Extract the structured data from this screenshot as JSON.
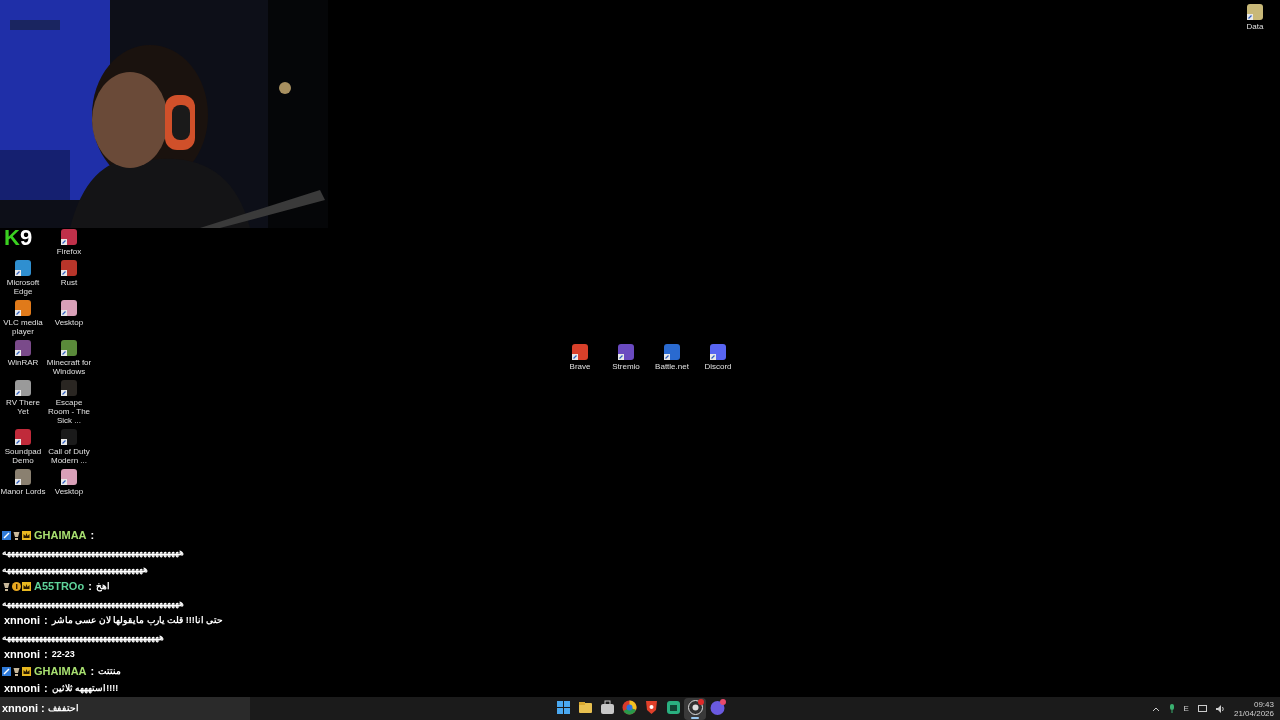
{
  "overlay_logo": {
    "letter": "K",
    "digit": "9"
  },
  "desktop_left_top": {
    "label": "Firefox",
    "color": "#c0304a"
  },
  "desktop_left": [
    {
      "label": "Microsoft Edge",
      "color": "#2f8fd0"
    },
    {
      "label": "Rust",
      "color": "#b8352a"
    },
    {
      "label": "VLC media player",
      "color": "#e07a1a"
    },
    {
      "label": "Vesktop",
      "color": "#d9a0b8"
    },
    {
      "label": "WinRAR",
      "color": "#7a4a8a"
    },
    {
      "label": "Minecraft for Windows",
      "color": "#5a8a3a"
    },
    {
      "label": "RV There Yet",
      "color": "#9a9a9a"
    },
    {
      "label": "Escape Room - The Sick ...",
      "color": "#2a2622"
    },
    {
      "label": "Soundpad Demo",
      "color": "#c02a3a"
    },
    {
      "label": "Call of Duty Modern ...",
      "color": "#1a1a1a"
    },
    {
      "label": "Manor Lords",
      "color": "#8a8070"
    },
    {
      "label": "Vesktop",
      "color": "#d9a0b8"
    }
  ],
  "desktop_center": [
    {
      "label": "Brave",
      "color": "#d8402a"
    },
    {
      "label": "Stremio",
      "color": "#6a4ac0"
    },
    {
      "label": "Battle.net",
      "color": "#2a6ad0"
    },
    {
      "label": "Discord",
      "color": "#5865f2"
    }
  ],
  "desktop_corner": {
    "label": "Data",
    "color": "#c8b878"
  },
  "chat": [
    {
      "user": "GHAIMAA",
      "separator": ":",
      "color": "#a8e070",
      "badges": [
        {
          "kind": "mod"
        },
        {
          "kind": "cup"
        },
        {
          "kind": "crown"
        }
      ],
      "lines": [
        "ههههههههههههههههههههههههههههههههههههههههههههه",
        "هههههههههههههههههههههههههههههههههههه"
      ]
    },
    {
      "user": "A55TROo",
      "separator": ":",
      "color": "#5fd39a",
      "badges": [
        {
          "kind": "cup"
        },
        {
          "kind": "coin"
        },
        {
          "kind": "crown"
        }
      ],
      "text": "اهخ",
      "lines": [
        "ههههههههههههههههههههههههههههههههههههههههههههه"
      ]
    },
    {
      "user": "xnnoni",
      "separator": ":",
      "color": "#ffffff",
      "text": "حتى انا!!! قلت يارب مايقولها لان عسى ماشر",
      "lines": [
        "هههههههههههههههههههههههههههههههههههههههه"
      ]
    },
    {
      "user": "xnnoni",
      "separator": ":",
      "color": "#ffffff",
      "text": "22-23"
    },
    {
      "user": "GHAIMAA",
      "separator": ":",
      "color": "#a8e070",
      "badges": [
        {
          "kind": "mod"
        },
        {
          "kind": "cup"
        },
        {
          "kind": "crown"
        }
      ],
      "text": "منتتت"
    },
    {
      "user": "xnnoni",
      "separator": ":",
      "color": "#ffffff",
      "text": "!!!!استهههه ثلاثين"
    }
  ],
  "chat_last": {
    "user": "xnnoni",
    "separator": ":",
    "text": "احتففف"
  },
  "taskbar": [
    {
      "kind": "start",
      "selected": false
    },
    {
      "kind": "folder",
      "selected": false
    },
    {
      "kind": "store",
      "selected": false
    },
    {
      "kind": "browser",
      "selected": false
    },
    {
      "kind": "lion",
      "selected": false
    },
    {
      "kind": "app",
      "selected": false
    },
    {
      "kind": "record",
      "selected": true
    },
    {
      "kind": "chat",
      "selected": false
    }
  ],
  "tray": {
    "language": "E",
    "time": "09:43",
    "date": "21/04/2026"
  }
}
